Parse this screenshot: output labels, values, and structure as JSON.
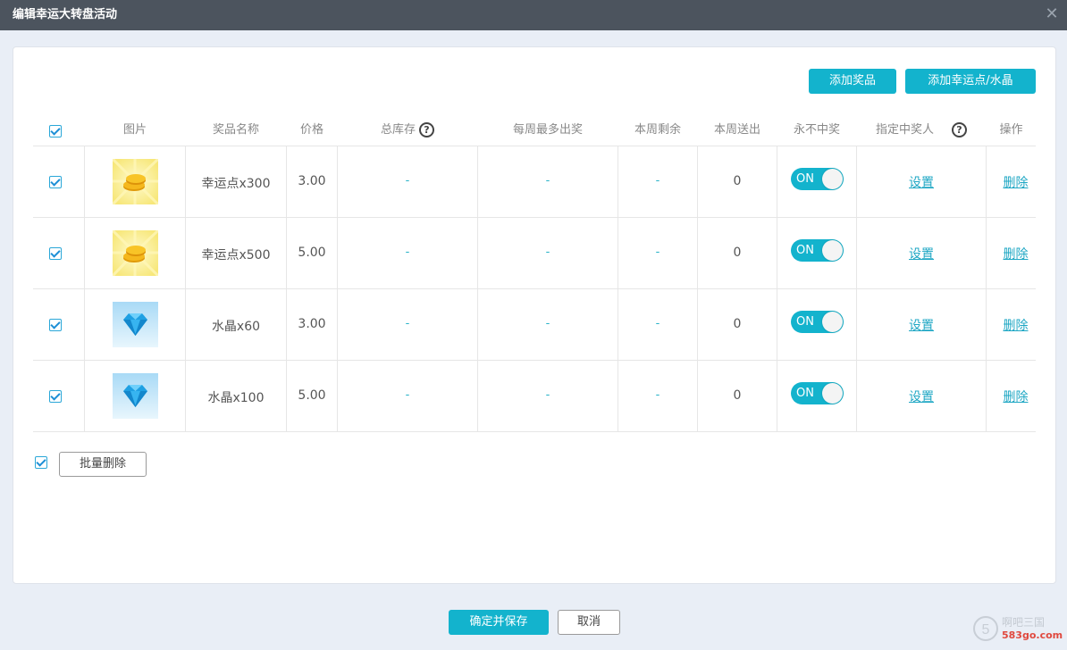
{
  "dialog": {
    "title": "编辑幸运大转盘活动",
    "close_glyph": "✕"
  },
  "toolbar": {
    "add_prize": "添加奖品",
    "add_lucky": "添加幸运点/水晶"
  },
  "table": {
    "headers": {
      "image": "图片",
      "name": "奖品名称",
      "price": "价格",
      "stock": "总库存",
      "weekly_max": "每周最多出奖",
      "week_remaining": "本周剩余",
      "week_sent": "本周送出",
      "never_win": "永不中奖",
      "winner": "指定中奖人",
      "action": "操作"
    },
    "help_glyph": "?",
    "rows": [
      {
        "icon": "gold-coins-icon",
        "name": "幸运点x300",
        "price": "3.00",
        "stock": "-",
        "weekly_max": "-",
        "week_remaining": "-",
        "week_sent": "0",
        "toggle": "ON",
        "set": "设置",
        "delete": "删除"
      },
      {
        "icon": "gold-coins-icon",
        "name": "幸运点x500",
        "price": "5.00",
        "stock": "-",
        "weekly_max": "-",
        "week_remaining": "-",
        "week_sent": "0",
        "toggle": "ON",
        "set": "设置",
        "delete": "删除"
      },
      {
        "icon": "blue-diamond-icon",
        "name": "水晶x60",
        "price": "3.00",
        "stock": "-",
        "weekly_max": "-",
        "week_remaining": "-",
        "week_sent": "0",
        "toggle": "ON",
        "set": "设置",
        "delete": "删除"
      },
      {
        "icon": "blue-diamond-icon",
        "name": "水晶x100",
        "price": "5.00",
        "stock": "-",
        "weekly_max": "-",
        "week_remaining": "-",
        "week_sent": "0",
        "toggle": "ON",
        "set": "设置",
        "delete": "删除"
      }
    ]
  },
  "batch_delete": "批量删除",
  "footer": {
    "confirm": "确定并保存",
    "cancel": "取消"
  },
  "watermark": {
    "brand": "啊吧三国",
    "url": "583go.com"
  },
  "colors": {
    "accent": "#13b3cd",
    "titlebar": "#4c545e",
    "link": "#1fa7c4"
  }
}
